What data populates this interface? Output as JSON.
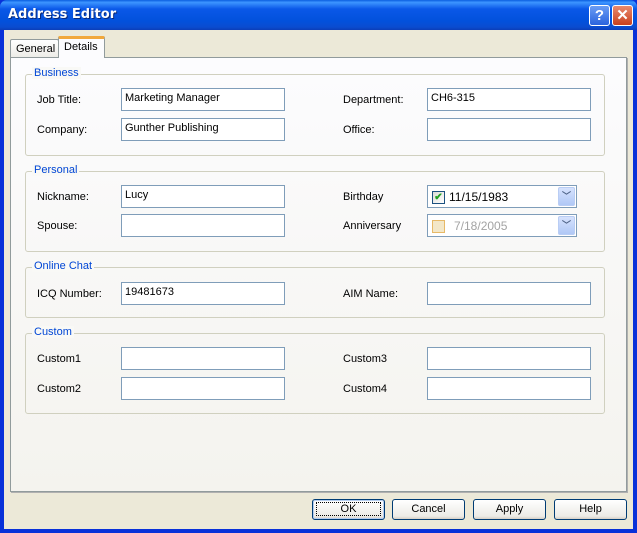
{
  "window": {
    "title": "Address Editor",
    "help_icon": "?",
    "close_icon": "✕"
  },
  "tabs": [
    {
      "label": "General",
      "active": false
    },
    {
      "label": "Details",
      "active": true
    }
  ],
  "groups": {
    "business": {
      "title": "Business",
      "job_title": {
        "label": "Job Title:",
        "value": "Marketing Manager"
      },
      "company": {
        "label": "Company:",
        "value": "Gunther Publishing"
      },
      "department": {
        "label": "Department:",
        "value": "CH6-315"
      },
      "office": {
        "label": "Office:",
        "value": ""
      }
    },
    "personal": {
      "title": "Personal",
      "nickname": {
        "label": "Nickname:",
        "value": "Lucy"
      },
      "spouse": {
        "label": "Spouse:",
        "value": ""
      },
      "birthday": {
        "label": "Birthday",
        "value": "11/15/1983",
        "checked": true,
        "check_glyph": "✔"
      },
      "anniversary": {
        "label": "Anniversary",
        "value": "7/18/2005",
        "checked": false
      }
    },
    "online_chat": {
      "title": "Online Chat",
      "icq": {
        "label": "ICQ Number:",
        "value": "19481673"
      },
      "aim": {
        "label": "AIM Name:",
        "value": ""
      }
    },
    "custom": {
      "title": "Custom",
      "custom1": {
        "label": "Custom1",
        "value": ""
      },
      "custom2": {
        "label": "Custom2",
        "value": ""
      },
      "custom3": {
        "label": "Custom3",
        "value": ""
      },
      "custom4": {
        "label": "Custom4",
        "value": ""
      }
    }
  },
  "dropdown_glyph": "﹀",
  "buttons": {
    "ok": "OK",
    "cancel": "Cancel",
    "apply": "Apply",
    "help": "Help"
  }
}
